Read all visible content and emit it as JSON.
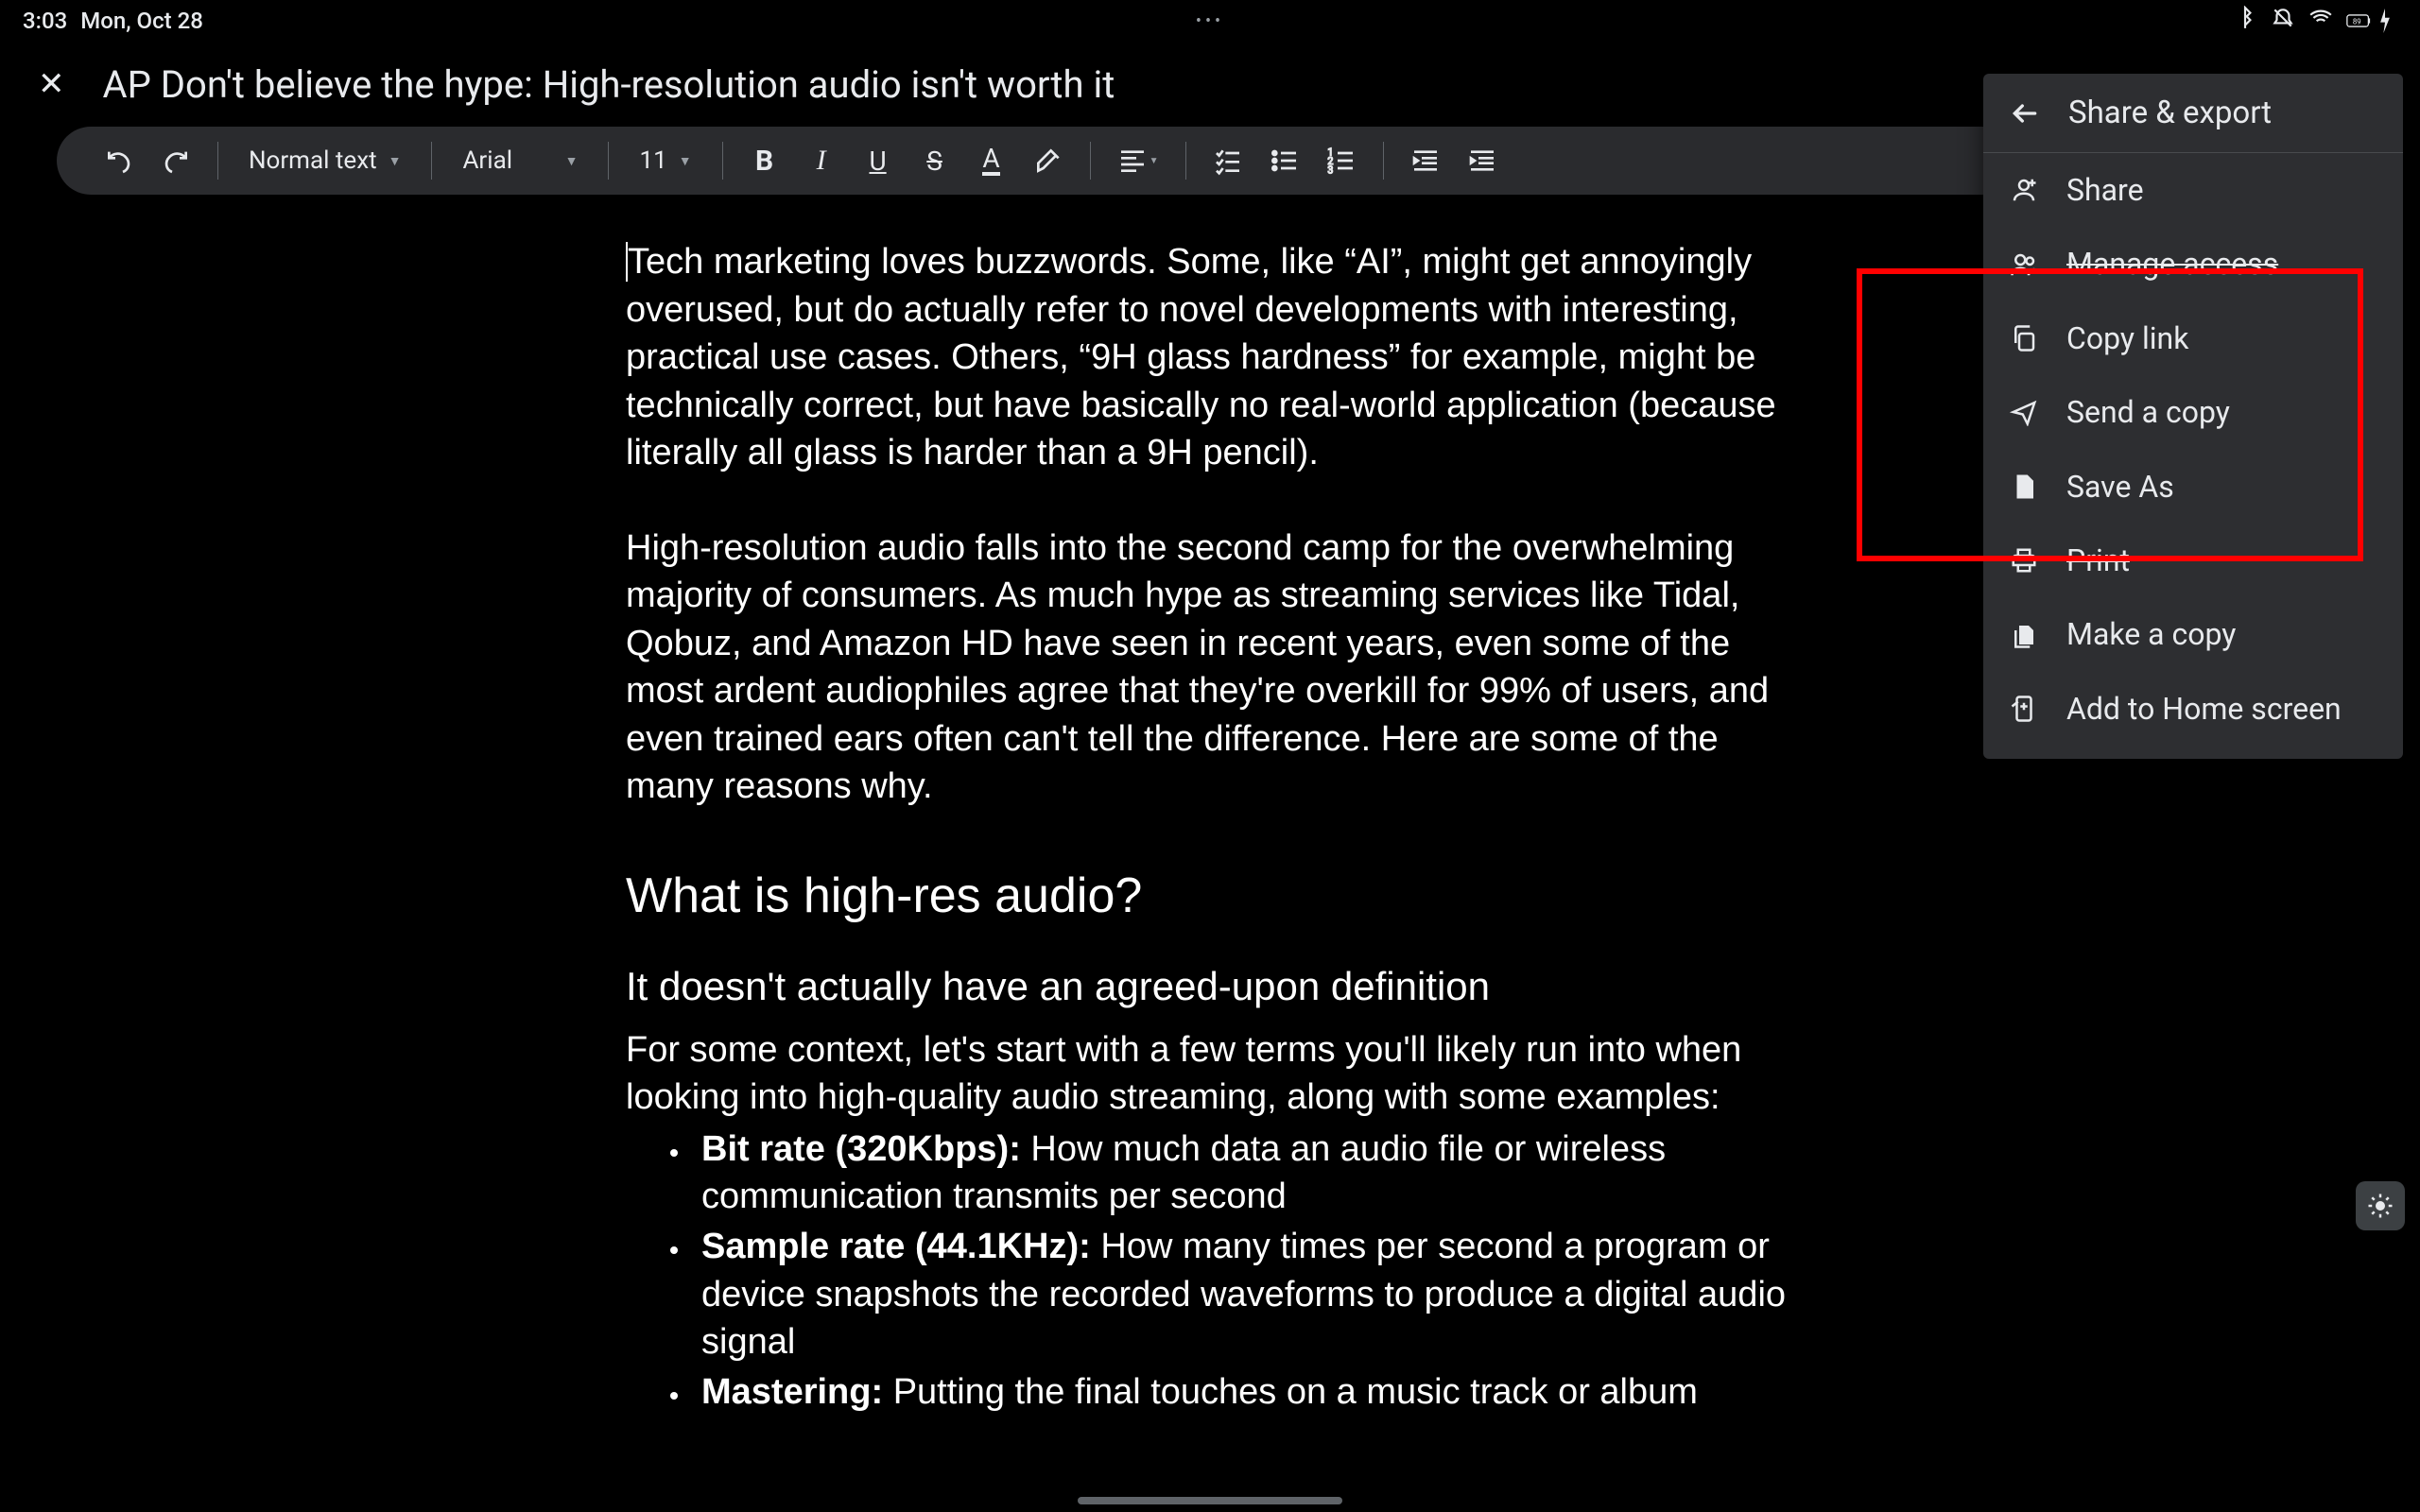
{
  "status": {
    "time": "3:03",
    "date": "Mon, Oct 28",
    "battery": "89"
  },
  "title_bar": {
    "doc_title": "AP Don't believe the hype: High-resolution audio isn't worth it"
  },
  "toolbar": {
    "style_label": "Normal text",
    "font_label": "Arial",
    "size_label": "11"
  },
  "document": {
    "para1": "Tech marketing loves buzzwords. Some, like “AI”, might get annoyingly overused, but do actually refer to novel developments with interesting, practical use cases. Others, “9H glass hardness” for example, might be technically correct, but have basically no real-world application (because literally all glass is harder than a 9H pencil).",
    "para2": "High-resolution audio falls into the second camp for the overwhelming majority of consumers. As much hype as streaming services like Tidal, Qobuz, and Amazon HD have seen in recent years, even some of the most ardent audiophiles agree that they're overkill for 99% of users, and even trained ears often can't tell the difference. Here are some of the many reasons why.",
    "h2": "What is high-res audio?",
    "h3": "It doesn't actually have an agreed-upon definition",
    "para3": "For some context, let's start with a few terms you'll likely run into when looking into high-quality audio streaming, along with some examples:",
    "bullets": [
      {
        "term": "Bit rate (320Kbps):",
        "def": " How much data an audio file or wireless communication transmits per second"
      },
      {
        "term": "Sample rate (44.1KHz):",
        "def": " How many times per second a program or device snapshots the recorded waveforms to produce a digital audio signal"
      },
      {
        "term": "Mastering:",
        "def": " Putting the final touches on a music track or album"
      }
    ]
  },
  "menu": {
    "title": "Share & export",
    "items": [
      {
        "label": "Share",
        "icon": "person-add"
      },
      {
        "label": "Manage access",
        "icon": "group",
        "strike": true
      },
      {
        "label": "Copy link",
        "icon": "copy"
      },
      {
        "label": "Send a copy",
        "icon": "send"
      },
      {
        "label": "Save As",
        "icon": "file"
      },
      {
        "label": "Print",
        "icon": "print",
        "strike": true
      },
      {
        "label": "Make a copy",
        "icon": "copy-file"
      },
      {
        "label": "Add to Home screen",
        "icon": "add-home"
      }
    ]
  }
}
